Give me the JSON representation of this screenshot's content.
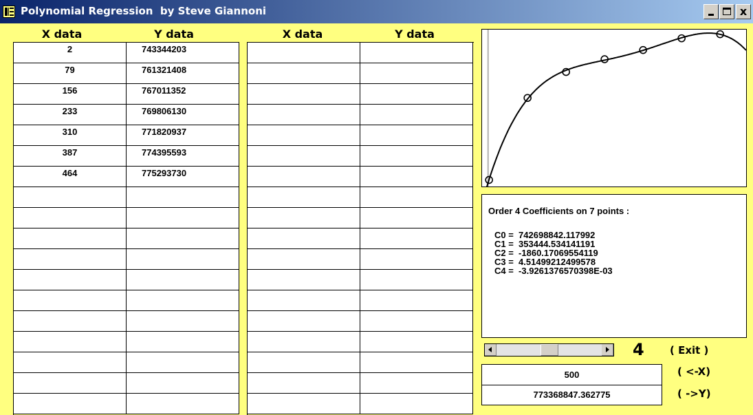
{
  "window": {
    "title": "Polynomial Regression  by Steve Giannoni",
    "minimize_label": "_",
    "close_label": "x"
  },
  "columns": {
    "x_header": "X data",
    "y_header": "Y data"
  },
  "data_points": [
    {
      "x": "2",
      "y": "743344203"
    },
    {
      "x": "79",
      "y": "761321408"
    },
    {
      "x": "156",
      "y": "767011352"
    },
    {
      "x": "233",
      "y": "769806130"
    },
    {
      "x": "310",
      "y": "771820937"
    },
    {
      "x": "387",
      "y": "774395593"
    },
    {
      "x": "464",
      "y": "775293730"
    }
  ],
  "coefficients": {
    "heading": "Order 4 Coefficients on 7 points :",
    "lines": [
      "C0 =  742698842.117992",
      "C1 =  353444.534141191",
      "C2 =  -1860.17069554119",
      "C3 =  4.51499212499578",
      "C4 =  -3.9261376570398E-03"
    ]
  },
  "order": {
    "value": "4",
    "slider_fraction": 0.5
  },
  "commands": {
    "exit": "( Exit )",
    "to_x": "( <-X)",
    "to_y": "( ->Y)"
  },
  "eval": {
    "x_value": "500",
    "y_value": "773368847.362775"
  },
  "plot": {
    "type": "scatter",
    "points": [
      [
        2,
        743344203
      ],
      [
        79,
        761321408
      ],
      [
        156,
        767011352
      ],
      [
        233,
        769806130
      ],
      [
        310,
        771820937
      ],
      [
        387,
        774395593
      ],
      [
        464,
        775293730
      ]
    ],
    "coefficients": [
      742698842.117992,
      353444.534141191,
      -1860.17069554119,
      4.51499212499578,
      -0.0039261376570398
    ],
    "xlim": [
      -12,
      516
    ],
    "ylim": [
      741900000,
      776300000
    ]
  }
}
